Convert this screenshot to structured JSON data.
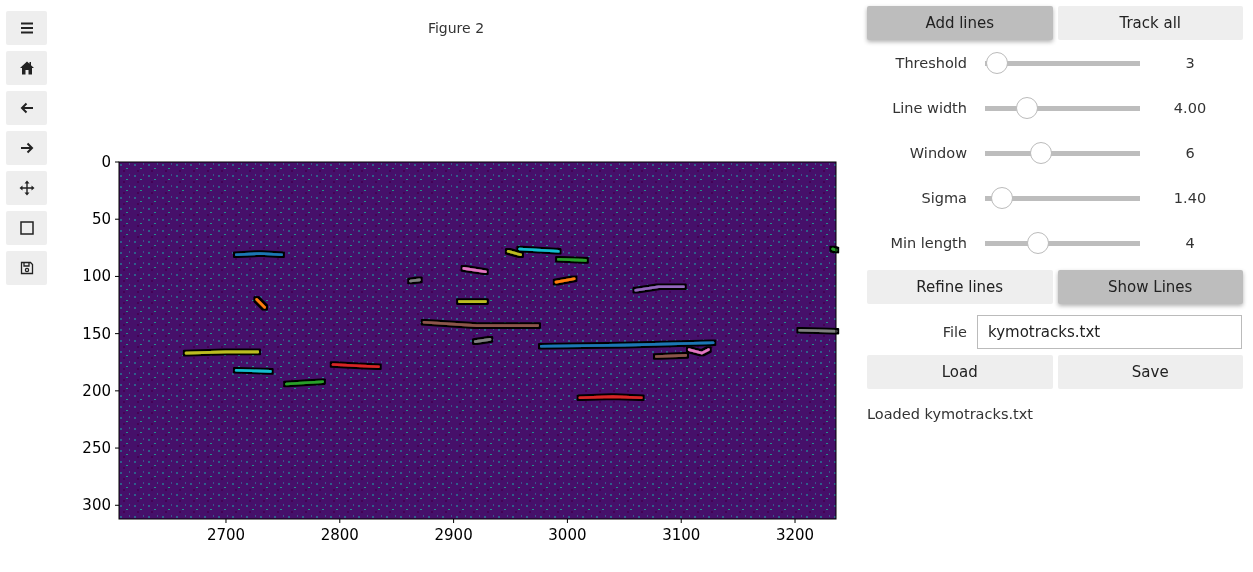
{
  "figure": {
    "title": "Figure 2",
    "chart_data": {
      "type": "line",
      "xlim": [
        2606,
        3236
      ],
      "ylim": [
        312,
        0
      ],
      "xticks": [
        2700,
        2800,
        2900,
        3000,
        3100,
        3200
      ],
      "yticks": [
        0,
        50,
        100,
        150,
        200,
        250,
        300
      ],
      "series": [
        {
          "color": "#1f77b4",
          "x": [
            2709,
            2730,
            2749
          ],
          "values": [
            81,
            80,
            81
          ]
        },
        {
          "color": "#ff7f0e",
          "x": [
            2727,
            2734
          ],
          "values": [
            120,
            127
          ]
        },
        {
          "color": "#bcbd22",
          "x": [
            2665,
            2700,
            2728
          ],
          "values": [
            167,
            166,
            166
          ]
        },
        {
          "color": "#17becf",
          "x": [
            2709,
            2739
          ],
          "values": [
            182,
            183
          ]
        },
        {
          "color": "#2ca02c",
          "x": [
            2753,
            2770,
            2785
          ],
          "values": [
            194,
            193,
            192
          ]
        },
        {
          "color": "#d62728",
          "x": [
            2794,
            2815,
            2834
          ],
          "values": [
            177,
            178,
            179
          ]
        },
        {
          "color": "#7f7f7f",
          "x": [
            2862,
            2870
          ],
          "values": [
            104,
            103
          ]
        },
        {
          "color": "#e377c2",
          "x": [
            2909,
            2928
          ],
          "values": [
            93,
            96
          ]
        },
        {
          "color": "#bcbd22",
          "x": [
            2905,
            2928
          ],
          "values": [
            122,
            122
          ]
        },
        {
          "color": "#8c564b",
          "x": [
            2874,
            2920,
            2974
          ],
          "values": [
            140,
            143,
            143
          ]
        },
        {
          "color": "#7f7f7f",
          "x": [
            2919,
            2932
          ],
          "values": [
            157,
            155
          ]
        },
        {
          "color": "#bcbd22",
          "x": [
            2948,
            2959
          ],
          "values": [
            78,
            81
          ]
        },
        {
          "color": "#17becf",
          "x": [
            2958,
            2992
          ],
          "values": [
            76,
            78
          ]
        },
        {
          "color": "#2ca02c",
          "x": [
            2992,
            3016
          ],
          "values": [
            85,
            86
          ]
        },
        {
          "color": "#ff7f0e",
          "x": [
            2990,
            3006
          ],
          "values": [
            105,
            102
          ]
        },
        {
          "color": "#9467bd",
          "x": [
            3060,
            3080,
            3102
          ],
          "values": [
            112,
            109,
            109
          ]
        },
        {
          "color": "#1f77b4",
          "x": [
            2977,
            3050,
            3128
          ],
          "values": [
            161,
            160,
            158
          ]
        },
        {
          "color": "#8c564b",
          "x": [
            3078,
            3104
          ],
          "values": [
            170,
            169
          ]
        },
        {
          "color": "#e377c2",
          "x": [
            3107,
            3118,
            3124
          ],
          "values": [
            164,
            167,
            164
          ]
        },
        {
          "color": "#d62728",
          "x": [
            3011,
            3040,
            3065
          ],
          "values": [
            206,
            205,
            206
          ]
        },
        {
          "color": "#7f7f7f",
          "x": [
            3204,
            3236
          ],
          "values": [
            147,
            148
          ]
        },
        {
          "color": "#2ca02c",
          "x": [
            3233,
            3236
          ],
          "values": [
            76,
            77
          ]
        }
      ]
    }
  },
  "panel": {
    "mode_buttons": [
      {
        "label": "Add lines",
        "selected": true
      },
      {
        "label": "Track all",
        "selected": false
      }
    ],
    "sliders": [
      {
        "label": "Threshold",
        "level": 0.08,
        "reading": "3"
      },
      {
        "label": "Line width",
        "level": 0.27,
        "reading": "4.00"
      },
      {
        "label": "Window",
        "level": 0.36,
        "reading": "6"
      },
      {
        "label": "Sigma",
        "level": 0.11,
        "reading": "1.40"
      },
      {
        "label": "Min length",
        "level": 0.34,
        "reading": "4"
      }
    ],
    "view_buttons": [
      {
        "label": "Refine lines",
        "selected": false
      },
      {
        "label": "Show Lines",
        "selected": true
      }
    ],
    "file": {
      "label": "File",
      "value": "kymotracks.txt"
    },
    "file_buttons": [
      "Load",
      "Save"
    ],
    "status": "Loaded kymotracks.txt"
  }
}
